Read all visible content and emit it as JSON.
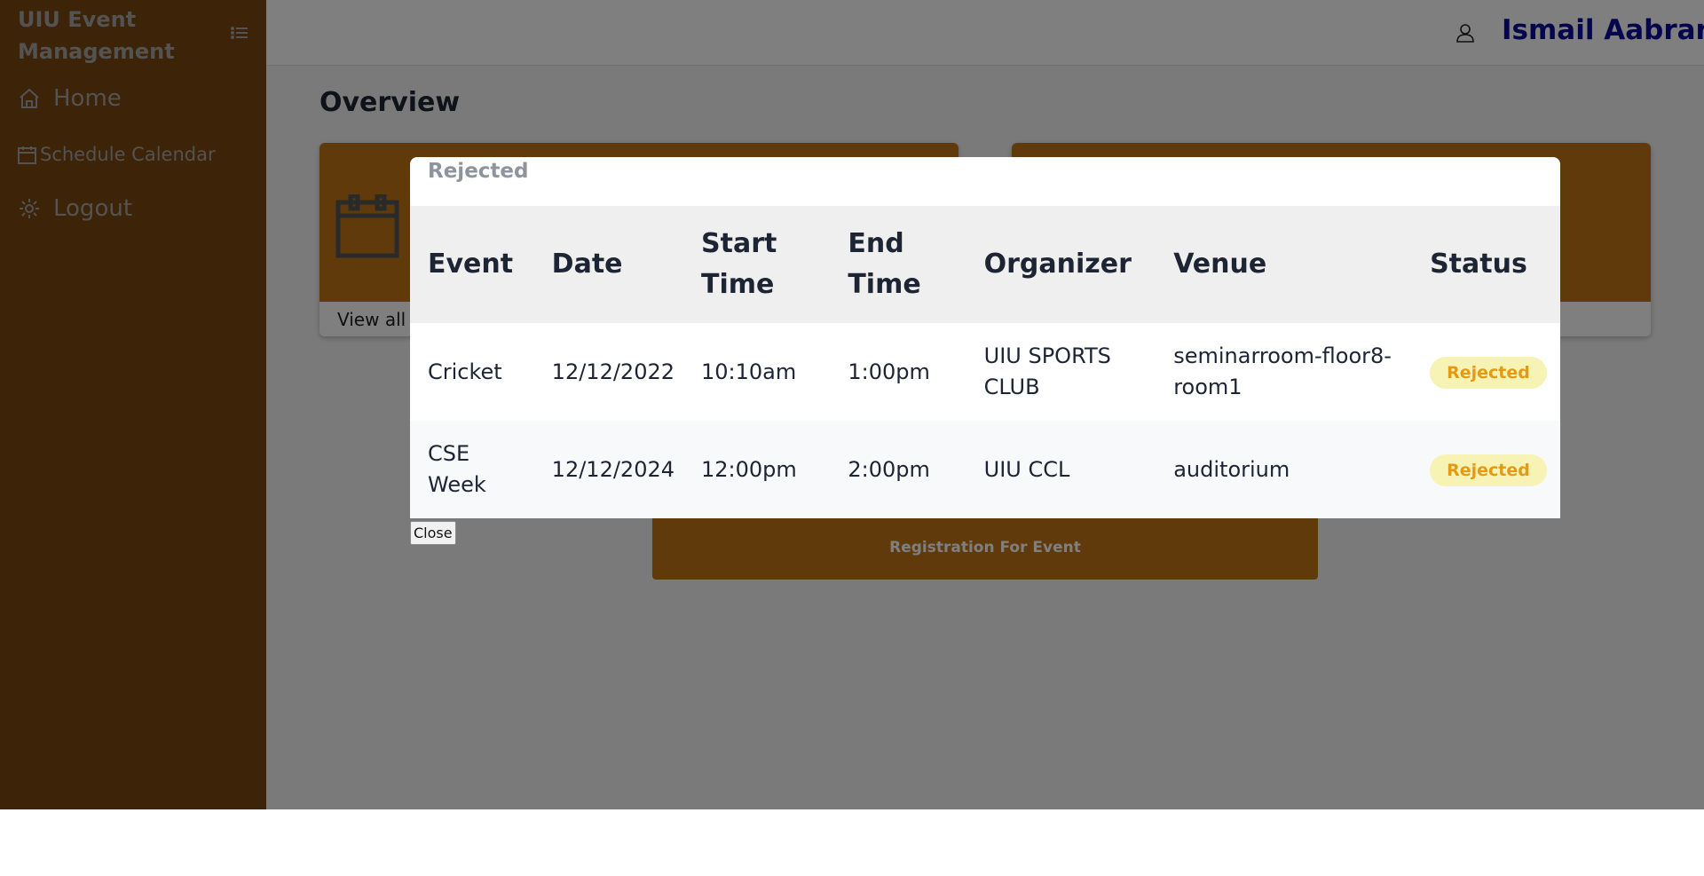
{
  "sidebar": {
    "brand": "UIU Event Management",
    "items": [
      {
        "label": "Home",
        "icon": "home-icon"
      },
      {
        "label": "Schedule Calendar",
        "icon": "calendar-icon"
      },
      {
        "label": "Logout",
        "icon": "gear-icon"
      }
    ]
  },
  "header": {
    "user_name": "Ismail Aabrar",
    "user_icon": "user-icon"
  },
  "main": {
    "title": "Overview",
    "card_link": "View all",
    "register_label": "Registration For Event"
  },
  "modal": {
    "title": "Rejected",
    "columns": [
      "Event",
      "Date",
      "Start Time",
      "End Time",
      "Organizer",
      "Venue",
      "Status"
    ],
    "rows": [
      {
        "event": "Cricket",
        "date": "12/12/2022",
        "start": "10:10am",
        "end": "1:00pm",
        "organizer": "UIU SPORTS CLUB",
        "venue": "seminarroom-floor8-room1",
        "status": "Rejected"
      },
      {
        "event": "CSE Week",
        "date": "12/12/2024",
        "start": "12:00pm",
        "end": "2:00pm",
        "organizer": "UIU CCL",
        "venue": "auditorium",
        "status": "Rejected"
      }
    ],
    "close_label": "Close"
  },
  "colors": {
    "sidebar": "#7a460f",
    "card": "#c07516",
    "user_name": "#0b0b9a",
    "badge_bg": "#f7f3b5",
    "badge_text": "#e49a12"
  }
}
